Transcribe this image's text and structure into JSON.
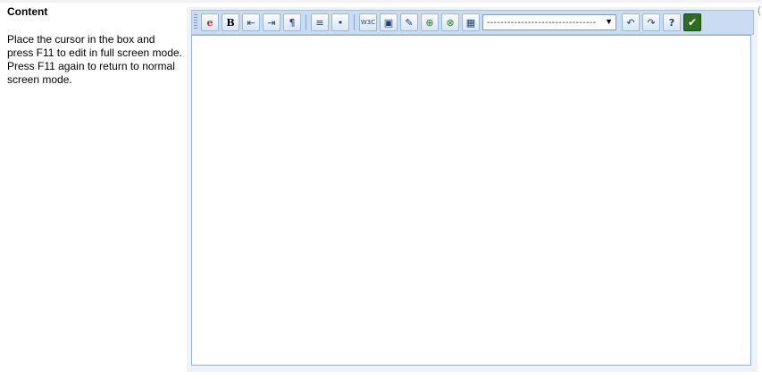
{
  "left": {
    "title": "Content",
    "description": "Place the cursor in the box and press F11 to edit in full screen mode. Press F11 again to return to normal screen mode."
  },
  "toolbar": {
    "buttons": [
      {
        "name": "ephox-icon",
        "glyph": "e"
      },
      {
        "name": "bold-icon",
        "glyph": "B"
      },
      {
        "name": "outdent-icon",
        "glyph": "⇤"
      },
      {
        "name": "indent-icon",
        "glyph": "⇥"
      },
      {
        "name": "paragraph-icon",
        "glyph": "¶"
      },
      {
        "name": "numbered-list-icon",
        "glyph": "≡"
      },
      {
        "name": "bulleted-list-icon",
        "glyph": "•"
      },
      {
        "name": "w3c-validate-icon",
        "glyph": "W3C"
      },
      {
        "name": "insert-image-icon",
        "glyph": "▣"
      },
      {
        "name": "insert-file-icon",
        "glyph": "✎"
      },
      {
        "name": "insert-link-icon",
        "glyph": "⊕"
      },
      {
        "name": "remove-link-icon",
        "glyph": "⊗"
      },
      {
        "name": "insert-table-icon",
        "glyph": "▦"
      },
      {
        "name": "undo-icon",
        "glyph": "↶"
      },
      {
        "name": "redo-icon",
        "glyph": "↷"
      },
      {
        "name": "help-icon",
        "glyph": "?"
      },
      {
        "name": "accept-icon",
        "glyph": "✔"
      }
    ],
    "style_select_value": "--------------------------------"
  },
  "edge_mark": "("
}
